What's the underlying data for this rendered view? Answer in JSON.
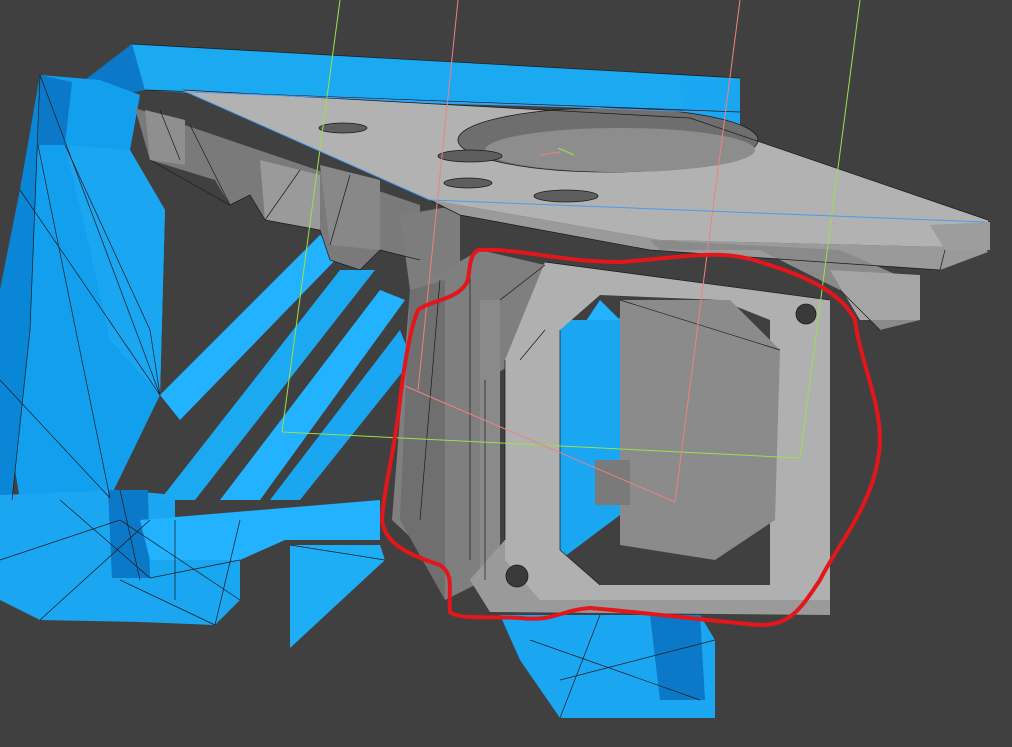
{
  "viewport": {
    "background": "#404040",
    "colors": {
      "support_blue": "#1aa6f0",
      "support_blue_dark": "#0b78c8",
      "support_blue_light": "#29b8ff",
      "model_gray": "#a8a8a8",
      "model_gray_dark": "#7a7a7a",
      "model_gray_light": "#bdbdbd",
      "edge_line": "#1b1b1b",
      "bbox_green": "#9be04a",
      "bbox_red": "#f08080",
      "bbox_blue": "#4a9cf0",
      "annotation_red": "#e3161b"
    }
  }
}
